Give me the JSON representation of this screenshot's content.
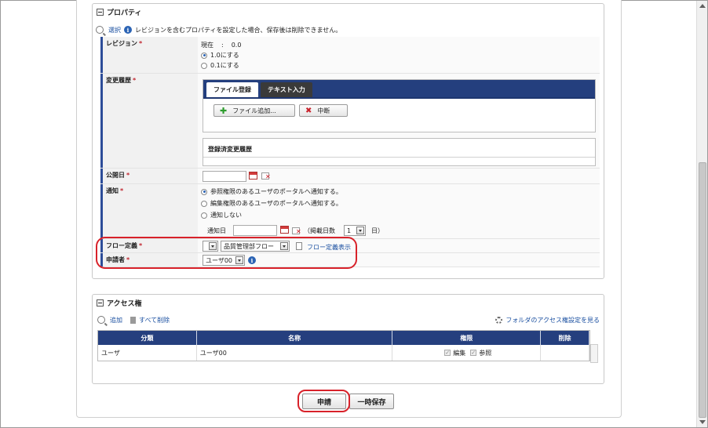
{
  "property_section": {
    "title": "プロパティ",
    "select_link": "選択",
    "info_text": "レビジョンを含むプロパティを設定した場合、保存後は削除できません。"
  },
  "revision": {
    "label": "レビジョン",
    "required_mark": "*",
    "current_label": "現在",
    "current_sep": ":",
    "current_value": "0.0",
    "options": [
      "1.0にする",
      "0.1にする"
    ],
    "selected_index": 0
  },
  "change_history": {
    "label": "変更履歴",
    "required_mark": "*",
    "tabs": [
      "ファイル登録",
      "テキスト入力"
    ],
    "active_tab": 0,
    "add_file_button": "ファイル追加...",
    "abort_button": "中断",
    "registered_title": "登録済変更履歴"
  },
  "publish_date": {
    "label": "公開日",
    "required_mark": "*",
    "value": ""
  },
  "notification": {
    "label": "通知",
    "required_mark": "*",
    "options": [
      "参照権限のあるユーザのポータルへ通知する。",
      "編集権限のあるユーザのポータルへ通知する。",
      "通知しない"
    ],
    "selected_index": 0,
    "date_label": "通知日",
    "date_value": "",
    "days_prefix": "（掲載日数",
    "days_value": "1",
    "days_suffix": "日）"
  },
  "flow": {
    "label": "フロー定義",
    "required_mark": "*",
    "first_select": "",
    "second_select": "品質管理部フロー",
    "show_link": "フロー定義表示"
  },
  "applicant": {
    "label": "申請者",
    "required_mark": "*",
    "value": "ユーザ00"
  },
  "access_section": {
    "title": "アクセス権",
    "add_link": "追加",
    "delete_all_link": "すべて削除",
    "folder_link": "フォルダのアクセス権設定を見る",
    "columns": [
      "分類",
      "名称",
      "権限",
      "削除"
    ],
    "rows": [
      {
        "category": "ユーザ",
        "name": "ユーザ00",
        "perm_edit": "編集",
        "perm_view": "参照"
      }
    ]
  },
  "footer": {
    "apply_button": "申請",
    "temp_save_button": "一時保存"
  },
  "colors": {
    "accent_navy": "#253f7e",
    "required_red": "#c0262f",
    "highlight_red": "#d8222a",
    "link_blue": "#1a4fa0"
  }
}
